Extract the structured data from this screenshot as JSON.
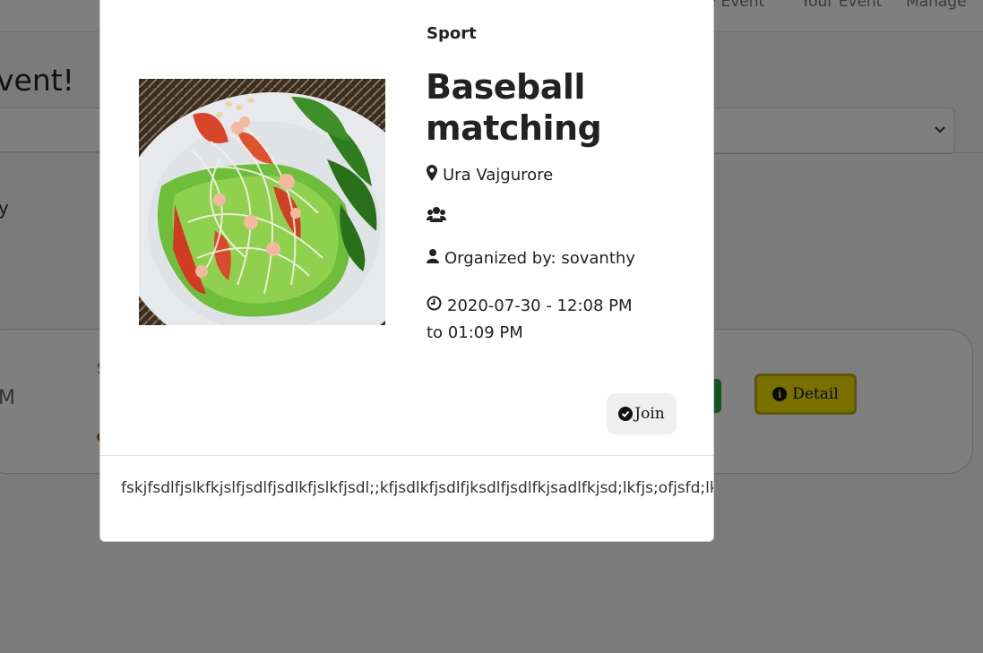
{
  "nav": {
    "links": [
      "re Event",
      "Your Event",
      "Manage"
    ]
  },
  "background": {
    "heading": "vent!",
    "partial_text_y": "y",
    "partial_text_m": "M",
    "partial_text_s": "S",
    "detail_button_label": "Detail"
  },
  "modal": {
    "category": "Sport",
    "title": "Baseball matching",
    "location": "Ura Vajgurore",
    "organizer": "Organized by: sovanthy",
    "datetime_line1": "2020-07-30 - 12:08 PM",
    "datetime_line2": "to 01:09 PM",
    "join_label": "Join",
    "description": "fskjfsdlfjslkfkjslfjsdlfjsdlkfjslkfjsdl;;kfjsdlkfjsdlfjksdlfjsdlfkjsadlfkjsd;lkfjs;ofjsfd;lk"
  },
  "icons": {
    "location": "map-marker-icon",
    "users": "users-icon",
    "organizer": "user-icon",
    "time": "clock-icon",
    "join": "check-circle-icon",
    "detail": "info-circle-icon"
  },
  "colors": {
    "detail_button": "#f3e000",
    "green_button": "#28a745",
    "backdrop": "rgba(0,0,0,0.5)"
  }
}
